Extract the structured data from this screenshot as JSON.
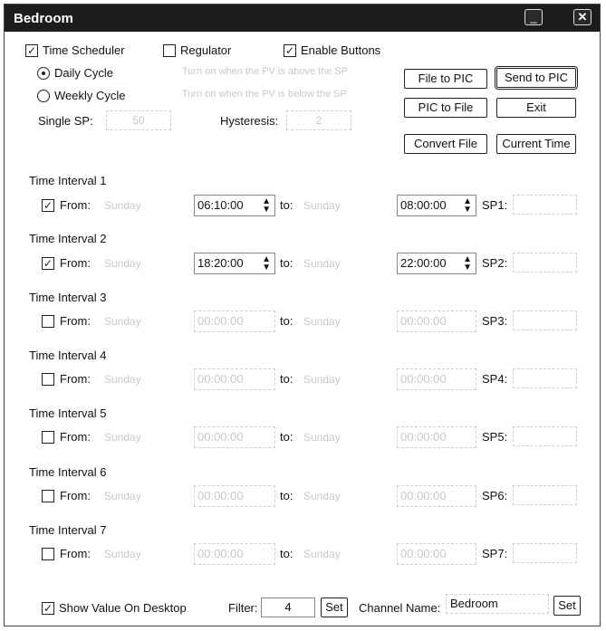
{
  "window": {
    "title": "Bedroom"
  },
  "options": {
    "time_scheduler": "Time Scheduler",
    "regulator": "Regulator",
    "enable_buttons": "Enable Buttons",
    "daily_cycle": "Daily Cycle",
    "weekly_cycle": "Weekly Cycle",
    "hint_above": "Turn on when the PV is above the SP",
    "hint_below": "Turn on when the PV is below the SP",
    "single_sp_label": "Single SP:",
    "single_sp_value": "50",
    "hysteresis_label": "Hysteresis:",
    "hysteresis_value": "2"
  },
  "buttons": {
    "file_to_pic": "File to PIC",
    "send_to_pic": "Send to PIC",
    "pic_to_file": "PIC to File",
    "exit": "Exit",
    "convert_file": "Convert File",
    "current_time": "Current Time"
  },
  "intervals": [
    {
      "label": "Time Interval 1",
      "from": "From:",
      "to": "to:",
      "day_from": "Sunday",
      "from_time": "06:10:00",
      "day_to": "Sunday",
      "to_time": "08:00:00",
      "sp_label": "SP1:",
      "sp_value": ""
    },
    {
      "label": "Time Interval 2",
      "from": "From:",
      "to": "to:",
      "day_from": "Sunday",
      "from_time": "18:20:00",
      "day_to": "Sunday",
      "to_time": "22:00:00",
      "sp_label": "SP2:",
      "sp_value": ""
    },
    {
      "label": "Time Interval 3",
      "from": "From:",
      "to": "to:",
      "day_from": "Sunday",
      "from_time": "00:00:00",
      "day_to": "Sunday",
      "to_time": "00:00:00",
      "sp_label": "SP3:",
      "sp_value": ""
    },
    {
      "label": "Time Interval 4",
      "from": "From:",
      "to": "to:",
      "day_from": "Sunday",
      "from_time": "00:00:00",
      "day_to": "Sunday",
      "to_time": "00:00:00",
      "sp_label": "SP4:",
      "sp_value": ""
    },
    {
      "label": "Time Interval 5",
      "from": "From:",
      "to": "to:",
      "day_from": "Sunday",
      "from_time": "00:00:00",
      "day_to": "Sunday",
      "to_time": "00:00:00",
      "sp_label": "SP5:",
      "sp_value": ""
    },
    {
      "label": "Time Interval 6",
      "from": "From:",
      "to": "to:",
      "day_from": "Sunday",
      "from_time": "00:00:00",
      "day_to": "Sunday",
      "to_time": "00:00:00",
      "sp_label": "SP6:",
      "sp_value": ""
    },
    {
      "label": "Time Interval 7",
      "from": "From:",
      "to": "to:",
      "day_from": "Sunday",
      "from_time": "00:00:00",
      "day_to": "Sunday",
      "to_time": "00:00:00",
      "sp_label": "SP7:",
      "sp_value": ""
    }
  ],
  "footer": {
    "show_value": "Show Value On Desktop",
    "filter_label": "Filter:",
    "filter_value": "4",
    "set_label": "Set",
    "channel_label": "Channel Name:",
    "channel_value": "Bedroom",
    "set2_label": "Set"
  }
}
